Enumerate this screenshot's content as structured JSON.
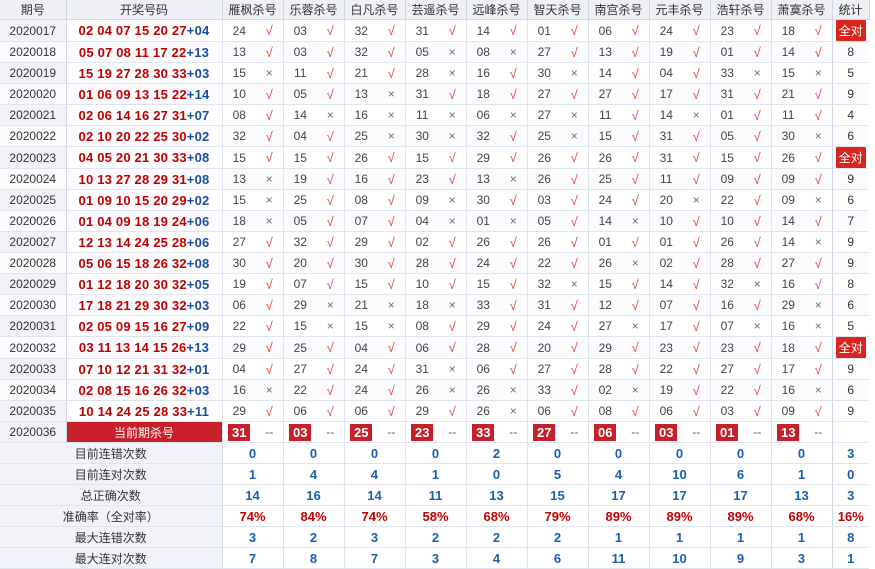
{
  "headers": {
    "period": "期号",
    "numbers": "开奖号码",
    "groups": [
      "雁枫杀号",
      "乐蓉杀号",
      "白凡杀号",
      "芸遥杀号",
      "远峰杀号",
      "智天杀号",
      "南宫杀号",
      "元丰杀号",
      "浩轩杀号",
      "萧寞杀号"
    ],
    "stat": "统计"
  },
  "marks": {
    "ok": "√",
    "err": "×"
  },
  "rows": [
    {
      "period": "2020017",
      "red": "02 04 07 15 20 27",
      "blue": "+04",
      "kills": [
        "24",
        "03",
        "32",
        "31",
        "14",
        "01",
        "06",
        "24",
        "23",
        "18"
      ],
      "res": [
        1,
        1,
        1,
        1,
        1,
        1,
        1,
        1,
        1,
        1
      ],
      "stat": "全对"
    },
    {
      "period": "2020018",
      "red": "05 07 08 11 17 22",
      "blue": "+13",
      "kills": [
        "13",
        "03",
        "32",
        "05",
        "08",
        "27",
        "13",
        "19",
        "01",
        "14"
      ],
      "res": [
        1,
        1,
        1,
        0,
        0,
        1,
        1,
        1,
        1,
        1
      ],
      "stat": "8"
    },
    {
      "period": "2020019",
      "red": "15 19 27 28 30 33",
      "blue": "+03",
      "kills": [
        "15",
        "11",
        "21",
        "28",
        "16",
        "30",
        "14",
        "04",
        "33",
        "15"
      ],
      "res": [
        0,
        1,
        1,
        0,
        1,
        0,
        1,
        1,
        0,
        0
      ],
      "stat": "5"
    },
    {
      "period": "2020020",
      "red": "01 06 09 13 15 22",
      "blue": "+14",
      "kills": [
        "10",
        "05",
        "13",
        "31",
        "18",
        "27",
        "27",
        "17",
        "31",
        "21"
      ],
      "res": [
        1,
        1,
        0,
        1,
        1,
        1,
        1,
        1,
        1,
        1
      ],
      "stat": "9"
    },
    {
      "period": "2020021",
      "red": "02 06 14 16 27 31",
      "blue": "+07",
      "kills": [
        "08",
        "14",
        "16",
        "11",
        "06",
        "27",
        "11",
        "14",
        "01",
        "11"
      ],
      "res": [
        1,
        0,
        0,
        0,
        0,
        0,
        1,
        0,
        1,
        1
      ],
      "stat": "4"
    },
    {
      "period": "2020022",
      "red": "02 10 20 22 25 30",
      "blue": "+02",
      "kills": [
        "32",
        "04",
        "25",
        "30",
        "32",
        "25",
        "15",
        "31",
        "05",
        "30"
      ],
      "res": [
        1,
        1,
        0,
        0,
        1,
        0,
        1,
        1,
        1,
        0
      ],
      "stat": "6"
    },
    {
      "period": "2020023",
      "red": "04 05 20 21 30 33",
      "blue": "+08",
      "kills": [
        "15",
        "15",
        "26",
        "15",
        "29",
        "26",
        "26",
        "31",
        "15",
        "26"
      ],
      "res": [
        1,
        1,
        1,
        1,
        1,
        1,
        1,
        1,
        1,
        1
      ],
      "stat": "全对"
    },
    {
      "period": "2020024",
      "red": "10 13 27 28 29 31",
      "blue": "+08",
      "kills": [
        "13",
        "19",
        "16",
        "23",
        "13",
        "26",
        "25",
        "11",
        "09",
        "09"
      ],
      "res": [
        0,
        1,
        1,
        1,
        0,
        1,
        1,
        1,
        1,
        1
      ],
      "stat": "9"
    },
    {
      "period": "2020025",
      "red": "01 09 10 15 20 29",
      "blue": "+02",
      "kills": [
        "15",
        "25",
        "08",
        "09",
        "30",
        "03",
        "24",
        "20",
        "22",
        "09"
      ],
      "res": [
        0,
        1,
        1,
        0,
        1,
        1,
        1,
        0,
        1,
        0
      ],
      "stat": "6"
    },
    {
      "period": "2020026",
      "red": "01 04 09 18 19 24",
      "blue": "+06",
      "kills": [
        "18",
        "05",
        "07",
        "04",
        "01",
        "05",
        "14",
        "10",
        "10",
        "14"
      ],
      "res": [
        0,
        1,
        1,
        0,
        0,
        1,
        0,
        1,
        1,
        1
      ],
      "stat": "7"
    },
    {
      "period": "2020027",
      "red": "12 13 14 24 25 28",
      "blue": "+06",
      "kills": [
        "27",
        "32",
        "29",
        "02",
        "26",
        "26",
        "01",
        "01",
        "26",
        "14"
      ],
      "res": [
        1,
        1,
        1,
        1,
        1,
        1,
        1,
        1,
        1,
        0
      ],
      "stat": "9"
    },
    {
      "period": "2020028",
      "red": "05 06 15 18 26 32",
      "blue": "+08",
      "kills": [
        "30",
        "20",
        "30",
        "28",
        "24",
        "22",
        "26",
        "02",
        "28",
        "27"
      ],
      "res": [
        1,
        1,
        1,
        1,
        1,
        1,
        0,
        1,
        1,
        1
      ],
      "stat": "9"
    },
    {
      "period": "2020029",
      "red": "01 12 18 20 30 32",
      "blue": "+05",
      "kills": [
        "19",
        "07",
        "15",
        "10",
        "15",
        "32",
        "15",
        "14",
        "32",
        "16"
      ],
      "res": [
        1,
        1,
        1,
        1,
        1,
        0,
        1,
        1,
        0,
        1
      ],
      "stat": "8"
    },
    {
      "period": "2020030",
      "red": "17 18 21 29 30 32",
      "blue": "+03",
      "kills": [
        "06",
        "29",
        "21",
        "18",
        "33",
        "31",
        "12",
        "07",
        "16",
        "29"
      ],
      "res": [
        1,
        0,
        0,
        0,
        1,
        1,
        1,
        1,
        1,
        0
      ],
      "stat": "6"
    },
    {
      "period": "2020031",
      "red": "02 05 09 15 16 27",
      "blue": "+09",
      "kills": [
        "22",
        "15",
        "15",
        "08",
        "29",
        "24",
        "27",
        "17",
        "07",
        "16"
      ],
      "res": [
        1,
        0,
        0,
        1,
        1,
        1,
        0,
        1,
        0,
        0
      ],
      "stat": "5"
    },
    {
      "period": "2020032",
      "red": "03 11 13 14 15 26",
      "blue": "+13",
      "kills": [
        "29",
        "25",
        "04",
        "06",
        "28",
        "20",
        "29",
        "23",
        "23",
        "18"
      ],
      "res": [
        1,
        1,
        1,
        1,
        1,
        1,
        1,
        1,
        1,
        1
      ],
      "stat": "全对"
    },
    {
      "period": "2020033",
      "red": "07 10 12 21 31 32",
      "blue": "+01",
      "kills": [
        "04",
        "27",
        "24",
        "31",
        "06",
        "27",
        "28",
        "22",
        "27",
        "17"
      ],
      "res": [
        1,
        1,
        1,
        0,
        1,
        1,
        1,
        1,
        1,
        1
      ],
      "stat": "9"
    },
    {
      "period": "2020034",
      "red": "02 08 15 16 26 32",
      "blue": "+03",
      "kills": [
        "16",
        "22",
        "24",
        "26",
        "26",
        "33",
        "02",
        "19",
        "22",
        "16"
      ],
      "res": [
        0,
        1,
        1,
        0,
        0,
        1,
        0,
        1,
        1,
        0
      ],
      "stat": "6"
    },
    {
      "period": "2020035",
      "red": "10 14 24 25 28 33",
      "blue": "+11",
      "kills": [
        "29",
        "06",
        "06",
        "29",
        "26",
        "06",
        "08",
        "06",
        "03",
        "09"
      ],
      "res": [
        1,
        1,
        1,
        1,
        0,
        1,
        1,
        1,
        1,
        1
      ],
      "stat": "9"
    }
  ],
  "current": {
    "period": "2020036",
    "label": "当前期杀号",
    "kills": [
      "31",
      "03",
      "25",
      "23",
      "33",
      "27",
      "06",
      "03",
      "01",
      "13"
    ],
    "placeholder": "--"
  },
  "summary": [
    {
      "label": "目前连错次数",
      "values": [
        "0",
        "0",
        "0",
        "0",
        "2",
        "0",
        "0",
        "0",
        "0",
        "0"
      ],
      "stat": "3",
      "kind": "num"
    },
    {
      "label": "目前连对次数",
      "values": [
        "1",
        "4",
        "4",
        "1",
        "0",
        "5",
        "4",
        "10",
        "6",
        "1"
      ],
      "stat": "0",
      "kind": "num"
    },
    {
      "label": "总正确次数",
      "values": [
        "14",
        "16",
        "14",
        "11",
        "13",
        "15",
        "17",
        "17",
        "17",
        "13"
      ],
      "stat": "3",
      "kind": "num"
    },
    {
      "label": "准确率（全对率）",
      "values": [
        "74%",
        "84%",
        "74%",
        "58%",
        "68%",
        "79%",
        "89%",
        "89%",
        "89%",
        "68%"
      ],
      "stat": "16%",
      "kind": "rate"
    },
    {
      "label": "最大连错次数",
      "values": [
        "3",
        "2",
        "3",
        "2",
        "2",
        "2",
        "1",
        "1",
        "1",
        "1"
      ],
      "stat": "8",
      "kind": "num"
    },
    {
      "label": "最大连对次数",
      "values": [
        "7",
        "8",
        "7",
        "3",
        "4",
        "6",
        "11",
        "10",
        "9",
        "3"
      ],
      "stat": "1",
      "kind": "num"
    }
  ]
}
